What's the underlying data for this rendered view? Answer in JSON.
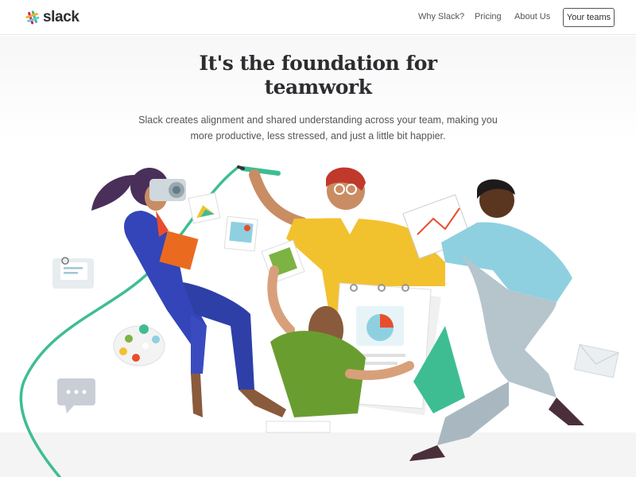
{
  "header": {
    "logo_text": "slack",
    "nav": {
      "why": "Why Slack?",
      "pricing": "Pricing",
      "about": "About Us"
    },
    "teams_button": "Your teams"
  },
  "hero": {
    "title_line1": "It's the foundation for",
    "title_line2": "teamwork",
    "subtitle_line1": "Slack creates alignment and shared understanding across your team, making you",
    "subtitle_line2": "more productive, less stressed, and just a little bit happier."
  },
  "colors": {
    "navy": "#2c2d30",
    "green_accent": "#3ebd93",
    "blue_suit": "#3345b8",
    "yellow_sweater": "#f2c12e",
    "green_shirt": "#6a9d2f",
    "light_blue_shirt": "#8fd0e0"
  },
  "illustration": {
    "description_icons": [
      "slack-logo-icon",
      "camera-icon",
      "pencil-icon",
      "paint-palette-icon",
      "chat-bubble-icon",
      "envelope-icon",
      "photo-card-icon",
      "pie-chart-card-icon",
      "line-chart-card-icon",
      "note-card-icon"
    ]
  }
}
